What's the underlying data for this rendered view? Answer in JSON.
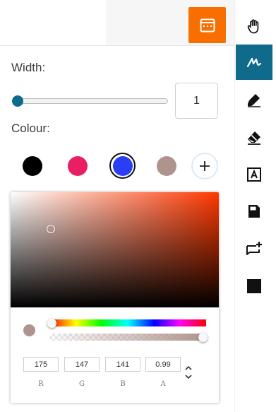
{
  "toolbar": {
    "tools": [
      {
        "name": "hand-tool",
        "icon": "hand-icon",
        "active": false
      },
      {
        "name": "pen-tool",
        "icon": "pen-icon",
        "active": true
      },
      {
        "name": "highlighter-tool",
        "icon": "highlighter-icon",
        "active": false
      },
      {
        "name": "eraser-tool",
        "icon": "eraser-icon",
        "active": false
      },
      {
        "name": "text-tool",
        "icon": "text-box-icon",
        "active": false
      },
      {
        "name": "stamp-tool",
        "icon": "stamp-icon",
        "active": false
      },
      {
        "name": "comment-tool",
        "icon": "add-comment-icon",
        "active": false
      },
      {
        "name": "shape-tool",
        "icon": "square-icon",
        "active": false
      }
    ],
    "accent_color": "#0f6a8c"
  },
  "header": {
    "keyboard_button_icon": "keyboard-icon",
    "button_color": "#f76f00"
  },
  "width": {
    "label": "Width:",
    "value": "1",
    "slider_fraction": 0.0
  },
  "colour": {
    "label": "Colour:",
    "swatches": [
      {
        "name": "black",
        "hex": "#000000",
        "selected": false
      },
      {
        "name": "pink",
        "hex": "#e91e63",
        "selected": false
      },
      {
        "name": "blue",
        "hex": "#2a3ef5",
        "selected": true
      },
      {
        "name": "taupe",
        "hex": "#af938d",
        "selected": false
      }
    ],
    "add_label": "+"
  },
  "picker": {
    "hue_color": "#ff3800",
    "current_color": "#af938d",
    "alpha": 0.99,
    "fields": [
      {
        "label": "R",
        "value": "175"
      },
      {
        "label": "G",
        "value": "147"
      },
      {
        "label": "B",
        "value": "141"
      },
      {
        "label": "A",
        "value": "0.99"
      }
    ]
  }
}
